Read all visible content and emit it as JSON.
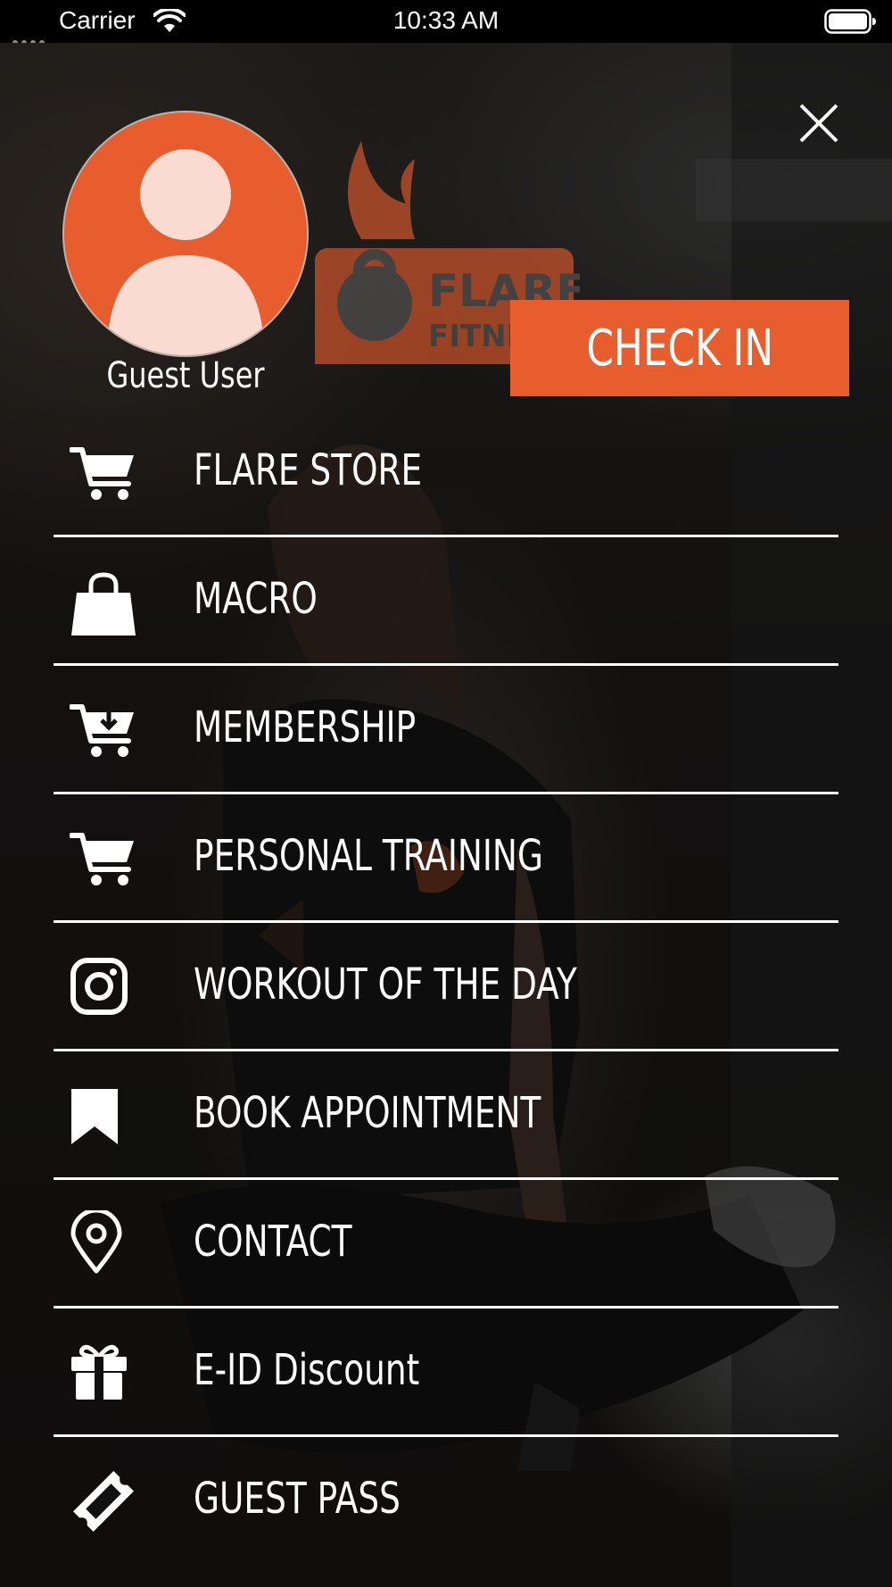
{
  "status_bar": {
    "carrier": "Carrier",
    "time": "10:33 AM"
  },
  "profile": {
    "name": "Guest User"
  },
  "brand": {
    "name": "FLARE",
    "sub": "FITNE",
    "color": "#e85d2e"
  },
  "check_in": {
    "label": "CHECK IN"
  },
  "menu": {
    "items": [
      {
        "label": "FLARE STORE",
        "icon": "cart-icon"
      },
      {
        "label": "MACRO",
        "icon": "shopping-bag-icon"
      },
      {
        "label": "MEMBERSHIP",
        "icon": "cart-download-icon"
      },
      {
        "label": "PERSONAL TRAINING",
        "icon": "cart-icon"
      },
      {
        "label": "WORKOUT OF THE DAY",
        "icon": "instagram-icon"
      },
      {
        "label": "BOOK APPOINTMENT",
        "icon": "bookmark-icon"
      },
      {
        "label": "CONTACT",
        "icon": "map-pin-icon"
      },
      {
        "label": "E-ID Discount",
        "icon": "gift-icon"
      },
      {
        "label": "GUEST PASS",
        "icon": "ticket-icon"
      }
    ]
  }
}
